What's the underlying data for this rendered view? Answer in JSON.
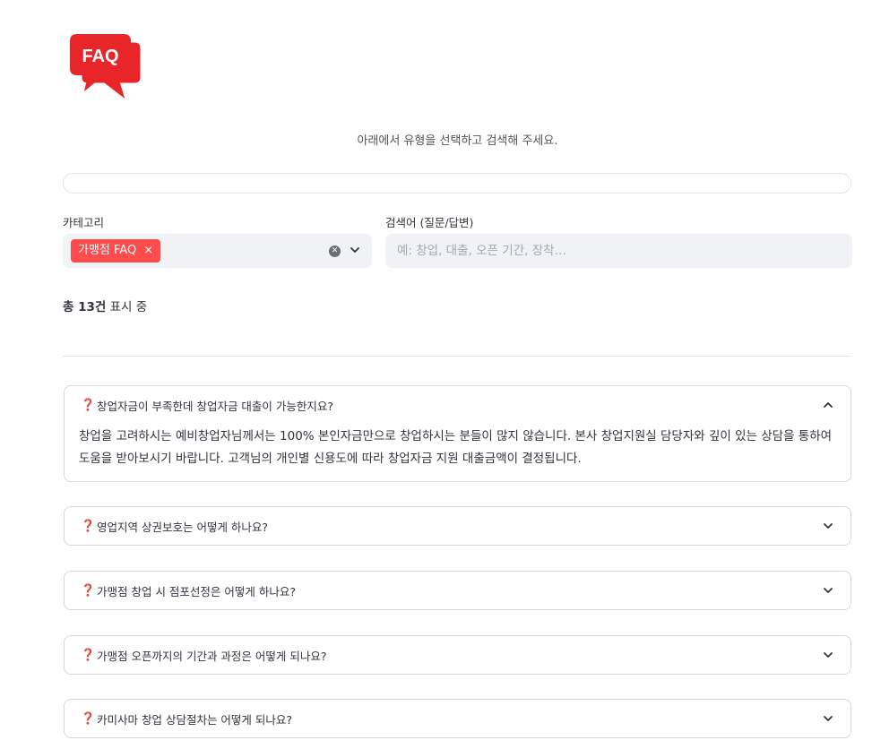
{
  "logo": {
    "text": "FAQ",
    "color": "#e8262a"
  },
  "subtitle": "아래에서 유형을 선택하고 검색해 주세요.",
  "category": {
    "label": "카테고리",
    "selected_chip": "가맹점 FAQ",
    "chip_remove": "×"
  },
  "search": {
    "label": "검색어 (질문/답변)",
    "placeholder": "예: 창업, 대출, 오픈 기간, 장착…"
  },
  "result": {
    "prefix": "총 13건",
    "suffix": " 표시 중"
  },
  "faqs": [
    {
      "question": "창업자금이 부족한데 창업자금 대출이 가능한지요?",
      "answer": "창업을 고려하시는 예비창업자님께서는 100% 본인자금만으로 창업하시는 분들이 많지 않습니다. 본사 창업지원실 담당자와 깊이 있는 상담을 통하여 도움을 받아보시기 바랍니다. 고객님의 개인별 신용도에 따라 창업자금 지원 대출금액이 결정됩니다.",
      "expanded": true
    },
    {
      "question": "영업지역 상권보호는 어떻게 하나요?",
      "expanded": false
    },
    {
      "question": "가맹점 창업 시 점포선정은 어떻게 하나요?",
      "expanded": false
    },
    {
      "question": "가맹점 오픈까지의 기간과 과정은 어떻게 되나요?",
      "expanded": false
    },
    {
      "question": "카미사마 창업 상담절차는 어떻게 되나요?",
      "expanded": false
    }
  ],
  "accent": "#ff4b4b",
  "question_icon": "question-mark-icon"
}
